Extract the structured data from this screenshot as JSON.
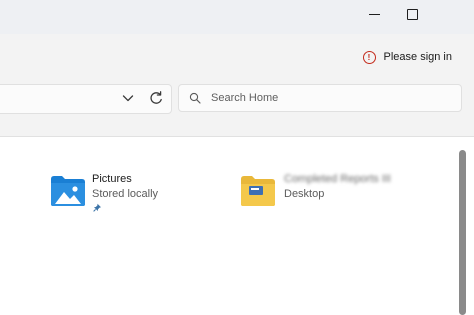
{
  "titlebar": {
    "controls": {
      "minimize_icon": "minimize-icon",
      "maximize_icon": "maximize-icon"
    }
  },
  "commandbar": {
    "signin_label": "Please sign in",
    "signin_icon": "alert-circle-icon",
    "signin_icon_color": "#c42b1c"
  },
  "navbar": {
    "dropdown_icon": "chevron-down-icon",
    "refresh_icon": "refresh-icon",
    "search": {
      "placeholder": "Search Home",
      "value": "",
      "icon": "search-icon"
    }
  },
  "items": [
    {
      "name": "Pictures",
      "location": "Stored locally",
      "icon": "pictures-folder-icon",
      "pinned": true,
      "pin_icon": "pin-icon"
    },
    {
      "name": "Completed Reports III",
      "location": "Desktop",
      "icon": "folder-icon",
      "name_blurred": true
    }
  ],
  "colors": {
    "folder_blue": "#1a7fd4",
    "folder_yellow": "#f4c84b",
    "chrome": "#f3f3f3"
  }
}
